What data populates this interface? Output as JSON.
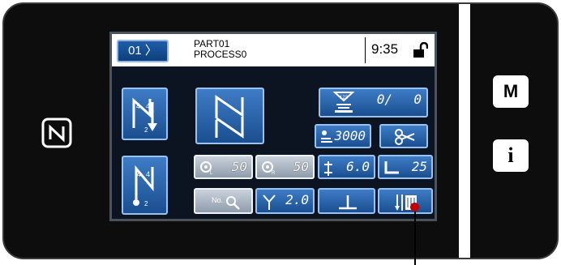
{
  "panel": {
    "pattern_number": "01",
    "part_name_line1": "PART01",
    "part_name_line2": "PROCESS0",
    "time": "9:35",
    "lock_icon": "unlocked-padlock-icon"
  },
  "stitch_buttons": {
    "reverse_start_icon": "reverse-feed-start-icon",
    "multilayer_icon": "multilayer-stitching-icon",
    "reverse_end_icon": "reverse-feed-end-icon"
  },
  "counter": {
    "value": "0/",
    "sub_value": "0",
    "icon": "bobbin-counter-icon"
  },
  "stitch_count": {
    "value": "3000",
    "icon": "presser-foot-count-icon"
  },
  "thread_trimmer": {
    "icon": "scissors-icon"
  },
  "tension_left": {
    "value": "50",
    "icon": "thread-tension-left-icon"
  },
  "tension_right": {
    "value": "50",
    "icon": "thread-tension-right-icon"
  },
  "stitch_length": {
    "value": "6.0",
    "icon": "stitch-length-icon"
  },
  "presser_foot": {
    "value": "25",
    "icon": "presser-foot-pressure-icon"
  },
  "search": {
    "label": "No.",
    "icon": "search-icon"
  },
  "needle_gauge": {
    "value": "2.0",
    "icon": "needle-gauge-icon"
  },
  "needle_up_down": {
    "icon": "needle-up-down-icon"
  },
  "one_shot_button": {
    "icon": "one-stitch-reverse-icon"
  },
  "side_buttons": {
    "mode_label": "M",
    "info_label": "i"
  },
  "colors": {
    "button_blue": "#1e5ea8",
    "button_gray": "#a9b4c1",
    "screen_bg": "#0b1420",
    "pointer": "#c00000"
  }
}
